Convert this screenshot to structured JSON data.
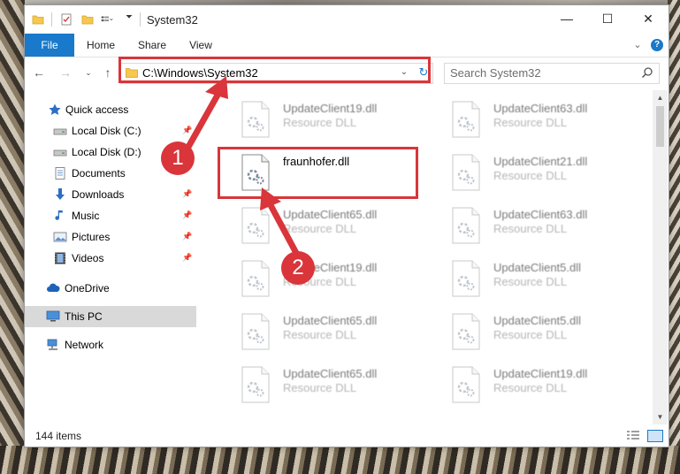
{
  "window": {
    "title": "System32",
    "controls": {
      "minimize": "—",
      "maximize": "☐",
      "close": "✕"
    }
  },
  "ribbon": {
    "tabs": [
      {
        "label": "File",
        "active": true
      },
      {
        "label": "Home"
      },
      {
        "label": "Share"
      },
      {
        "label": "View"
      }
    ]
  },
  "address_bar": {
    "path": "C:\\Windows\\System32"
  },
  "search": {
    "placeholder": "Search System32"
  },
  "sidebar": {
    "items": [
      {
        "label": "Quick access",
        "icon": "star-icon"
      },
      {
        "label": "Local Disk (C:)",
        "icon": "drive-icon",
        "pinned": true
      },
      {
        "label": "Local Disk (D:)",
        "icon": "drive-icon"
      },
      {
        "label": "Documents",
        "icon": "documents-icon"
      },
      {
        "label": "Downloads",
        "icon": "downloads-icon",
        "pinned": true
      },
      {
        "label": "Music",
        "icon": "music-icon",
        "pinned": true
      },
      {
        "label": "Pictures",
        "icon": "pictures-icon",
        "pinned": true
      },
      {
        "label": "Videos",
        "icon": "videos-icon",
        "pinned": true
      },
      {
        "label": "OneDrive",
        "icon": "cloud-icon"
      },
      {
        "label": "This PC",
        "icon": "computer-icon",
        "selected": true
      },
      {
        "label": "Network",
        "icon": "network-icon"
      }
    ]
  },
  "files": [
    {
      "name": "UpdateClient19.dll",
      "type": "Resource DLL"
    },
    {
      "name": "UpdateClient63.dll",
      "type": "Resource DLL"
    },
    {
      "name": "fraunhofer.dll",
      "type": "",
      "focused": true
    },
    {
      "name": "UpdateClient21.dll",
      "type": "Resource DLL"
    },
    {
      "name": "UpdateClient65.dll",
      "type": "Resource DLL"
    },
    {
      "name": "UpdateClient63.dll",
      "type": "Resource DLL"
    },
    {
      "name": "UpdateClient19.dll",
      "type": "Resource DLL"
    },
    {
      "name": "UpdateClient5.dll",
      "type": "Resource DLL"
    },
    {
      "name": "UpdateClient65.dll",
      "type": "Resource DLL"
    },
    {
      "name": "UpdateClient5.dll",
      "type": "Resource DLL"
    },
    {
      "name": "UpdateClient65.dll",
      "type": "Resource DLL"
    },
    {
      "name": "UpdateClient19.dll",
      "type": "Resource DLL"
    }
  ],
  "status": {
    "item_count": "144 items"
  },
  "annotations": {
    "step1": "1",
    "step2": "2",
    "color": "#d9353a"
  },
  "colors": {
    "accent": "#1979ca",
    "selected_bg": "#d9d9d9"
  }
}
